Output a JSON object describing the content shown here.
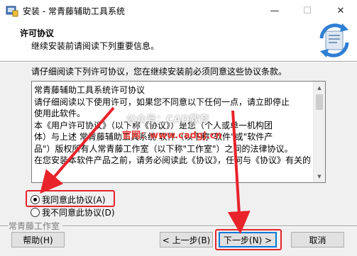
{
  "window": {
    "title": "安装 - 常青藤辅助工具系统",
    "min_glyph": "—",
    "max_glyph": "☐",
    "close_glyph": "✕"
  },
  "header": {
    "title": "许可协议",
    "subtitle": "继续安装前请阅读下列重要信息。"
  },
  "intro_text": "请仔细阅读下列许可协议，您在继续安装前必须同意这些协议条款。",
  "license": {
    "lines": [
      "常青藤辅助工具系统许可协议",
      "",
      "        请仔细阅读以下使用许可，如果您不同意以下任何一点，请立即停止",
      "使用此软件。",
      "        本《用户许可协议》（以下称《协议》）是您（个人或单一机构团",
      "体）与上述 常青藤辅助工具系统 软件（以下称\"软件\"或\"软件产",
      "品\"）版权所有人常青藤工作室（以下称\"工作室\"）之间的法律协议。",
      "在您安装本软件产品之前，请务必阅读此《协议》，任何与《协议》有关的"
    ]
  },
  "options": {
    "accept_label": "我同意此协议(A)",
    "decline_label": "我不同意此协议(D)",
    "selected": "accept"
  },
  "footer": {
    "company": "常青藤工作室",
    "help_label": "帮助(H)",
    "back_label": "< 上一步(B)",
    "next_label": "下一步(N) >",
    "cancel_label": "取消"
  },
  "watermark": {
    "line1": "公众号：CAD教育",
    "line2": "官网：www.cadgj.cn"
  },
  "colors": {
    "highlight": "#e8232a",
    "dialog_bg": "#f0f0f0",
    "default_button_border": "#0078d7"
  }
}
